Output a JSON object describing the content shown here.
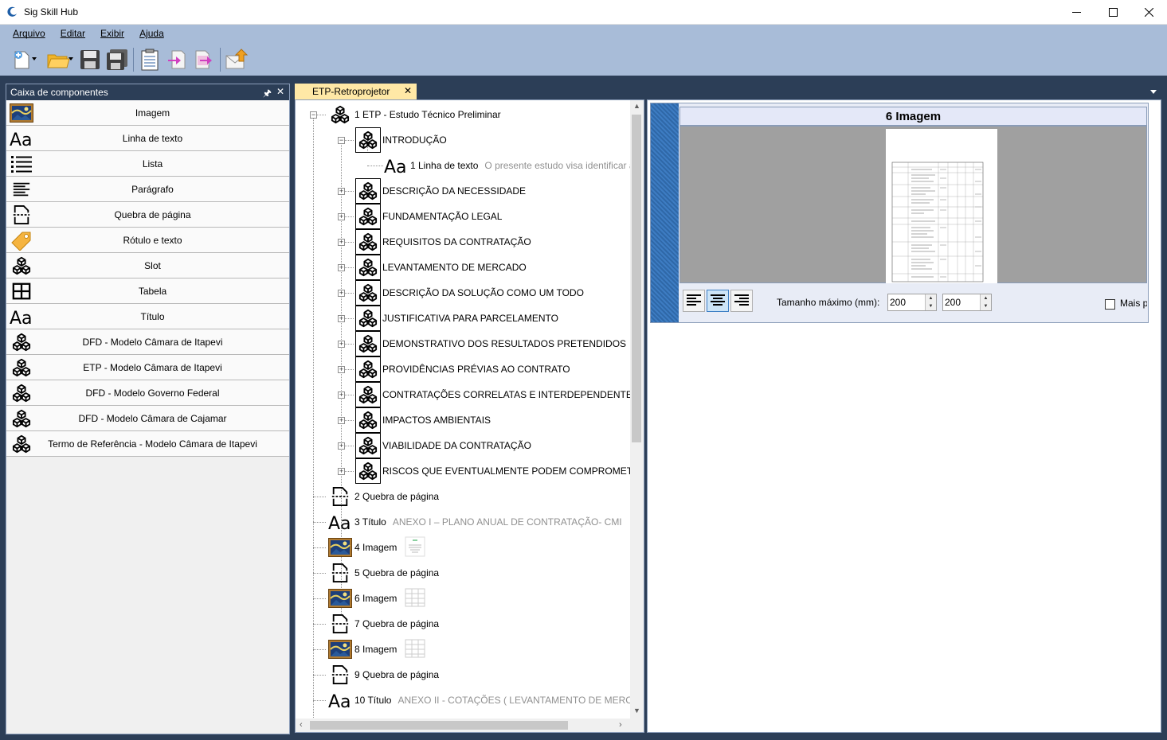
{
  "window": {
    "title": "Sig Skill Hub",
    "controls": [
      "minimize-icon",
      "maximize-icon",
      "close-icon"
    ]
  },
  "menu": {
    "items": [
      {
        "label_first": "A",
        "label_rest": "rquivo"
      },
      {
        "label_first": "",
        "label_mid": "E",
        "label_rest": "ditar",
        "prefix": ""
      },
      {
        "label_first": "E",
        "label_rest": "xibir"
      },
      {
        "label_first": "Aj",
        "label_rest": "uda"
      }
    ],
    "labels": [
      "Arquivo",
      "Editar",
      "Exibir",
      "Ajuda"
    ]
  },
  "toolbar": {
    "icons": [
      "new-document-icon",
      "open-folder-icon",
      "save-icon",
      "save-all-icon",
      "clipboard-list-icon",
      "import-icon",
      "export-icon",
      "send-mail-icon"
    ]
  },
  "components_panel": {
    "title": "Caixa de componentes",
    "items": [
      {
        "label": "Imagem",
        "icon": "image-icon"
      },
      {
        "label": "Linha de texto",
        "icon": "text-line-icon"
      },
      {
        "label": "Lista",
        "icon": "list-icon"
      },
      {
        "label": "Parágrafo",
        "icon": "paragraph-icon"
      },
      {
        "label": "Quebra de página",
        "icon": "page-break-icon"
      },
      {
        "label": "Rótulo e texto",
        "icon": "tag-icon"
      },
      {
        "label": "Slot",
        "icon": "cubes-icon"
      },
      {
        "label": "Tabela",
        "icon": "table-icon"
      },
      {
        "label": "Título",
        "icon": "title-icon"
      },
      {
        "label": "DFD - Modelo Câmara de Itapevi",
        "icon": "cubes-icon"
      },
      {
        "label": "ETP - Modelo Câmara de Itapevi",
        "icon": "cubes-icon"
      },
      {
        "label": "DFD - Modelo Governo Federal",
        "icon": "cubes-icon"
      },
      {
        "label": "DFD - Modelo Câmara de Cajamar",
        "icon": "cubes-icon"
      },
      {
        "label": "Termo de Referência - Modelo Câmara de Itapevi",
        "icon": "cubes-icon"
      }
    ]
  },
  "document": {
    "tab_label": "ETP-Retroprojetor",
    "tree": [
      {
        "level": 0,
        "label": "1 ETP - Estudo Técnico Preliminar",
        "icon": "cubes-icon",
        "expander": "minus"
      },
      {
        "level": 1,
        "label": "INTRODUÇÃO",
        "icon": "cubes-icon",
        "expander": "minus"
      },
      {
        "level": 2,
        "label": "1 Linha de texto",
        "icon": "text-line-icon",
        "preview": "O presente estudo visa identificar a"
      },
      {
        "level": 1,
        "label": "DESCRIÇÃO DA NECESSIDADE",
        "icon": "cubes-icon",
        "expander": "plus"
      },
      {
        "level": 1,
        "label": "FUNDAMENTAÇÃO LEGAL",
        "icon": "cubes-icon",
        "expander": "plus"
      },
      {
        "level": 1,
        "label": "REQUISITOS DA CONTRATAÇÃO",
        "icon": "cubes-icon",
        "expander": "plus"
      },
      {
        "level": 1,
        "label": "LEVANTAMENTO DE MERCADO",
        "icon": "cubes-icon",
        "expander": "plus"
      },
      {
        "level": 1,
        "label": "DESCRIÇÃO DA SOLUÇÃO COMO UM TODO",
        "icon": "cubes-icon",
        "expander": "plus"
      },
      {
        "level": 1,
        "label": "JUSTIFICATIVA PARA PARCELAMENTO",
        "icon": "cubes-icon",
        "expander": "plus"
      },
      {
        "level": 1,
        "label": "DEMONSTRATIVO DOS RESULTADOS PRETENDIDOS",
        "icon": "cubes-icon",
        "expander": "plus"
      },
      {
        "level": 1,
        "label": "PROVIDÊNCIAS PRÉVIAS AO CONTRATO",
        "icon": "cubes-icon",
        "expander": "plus"
      },
      {
        "level": 1,
        "label": "CONTRATAÇÕES CORRELATAS E INTERDEPENDENTES",
        "icon": "cubes-icon",
        "expander": "plus"
      },
      {
        "level": 1,
        "label": "IMPACTOS AMBIENTAIS",
        "icon": "cubes-icon",
        "expander": "plus"
      },
      {
        "level": 1,
        "label": "VIABILIDADE DA CONTRATAÇÃO",
        "icon": "cubes-icon",
        "expander": "plus"
      },
      {
        "level": 1,
        "label": "RISCOS QUE EVENTUALMENTE PODEM COMPROMETER O",
        "icon": "cubes-icon",
        "expander": "plus"
      },
      {
        "level": 0,
        "label": "2 Quebra de página",
        "icon": "page-break-icon"
      },
      {
        "level": 0,
        "label": "3 Título",
        "icon": "title-icon",
        "preview": "ANEXO I – PLANO ANUAL DE CONTRATAÇÃO- CMI"
      },
      {
        "level": 0,
        "label": "4 Imagem",
        "icon": "image-icon",
        "thumb": "document-thumbnail-icon"
      },
      {
        "level": 0,
        "label": "5 Quebra de página",
        "icon": "page-break-icon"
      },
      {
        "level": 0,
        "label": "6 Imagem",
        "icon": "image-icon",
        "thumb": "table-thumbnail-icon"
      },
      {
        "level": 0,
        "label": "7 Quebra de página",
        "icon": "page-break-icon"
      },
      {
        "level": 0,
        "label": "8 Imagem",
        "icon": "image-icon",
        "thumb": "table-thumbnail-icon"
      },
      {
        "level": 0,
        "label": "9 Quebra de página",
        "icon": "page-break-icon"
      },
      {
        "level": 0,
        "label": "10 Título",
        "icon": "title-icon",
        "preview": "ANEXO II - COTAÇÕES ( LEVANTAMENTO DE MERCADO"
      }
    ]
  },
  "image_editor": {
    "title": "6 Imagem",
    "size_label": "Tamanho máximo (mm):",
    "width_value": "200",
    "height_value": "200",
    "checkbox_label": "Mais p",
    "align_options": [
      "align-left-icon",
      "align-center-icon",
      "align-right-icon"
    ],
    "selected_align": "align-center-icon"
  },
  "colors": {
    "chrome": "#a8bcd8",
    "dark_frame": "#2c3e57",
    "tab_active": "#ffe8a6"
  }
}
